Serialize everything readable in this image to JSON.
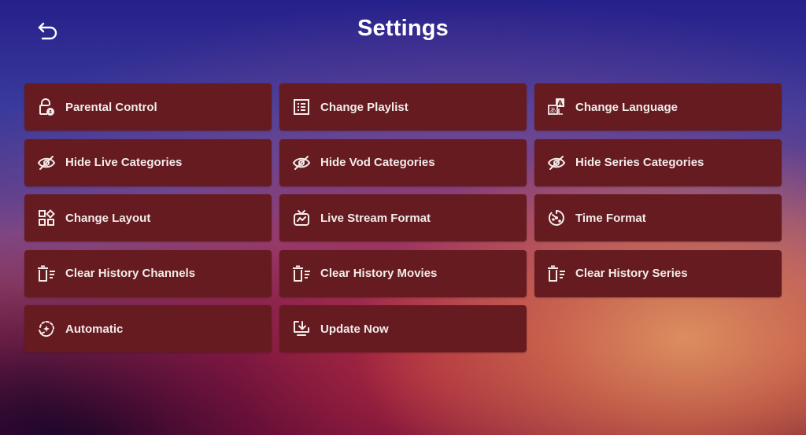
{
  "header": {
    "title": "Settings",
    "back_icon": "back-arrow-icon"
  },
  "settings": [
    {
      "label": "Parental Control",
      "icon": "lock-person-icon"
    },
    {
      "label": "Change Playlist",
      "icon": "list-icon"
    },
    {
      "label": "Change Language",
      "icon": "translate-icon"
    },
    {
      "label": "Hide Live Categories",
      "icon": "eye-off-icon"
    },
    {
      "label": "Hide Vod Categories",
      "icon": "eye-off-icon"
    },
    {
      "label": "Hide Series Categories",
      "icon": "eye-off-icon"
    },
    {
      "label": "Change Layout",
      "icon": "layout-grid-icon"
    },
    {
      "label": "Live Stream Format",
      "icon": "tv-icon"
    },
    {
      "label": "Time Format",
      "icon": "timer-icon"
    },
    {
      "label": "Clear History Channels",
      "icon": "delete-list-icon"
    },
    {
      "label": "Clear History Movies",
      "icon": "delete-list-icon"
    },
    {
      "label": "Clear History Series",
      "icon": "delete-list-icon"
    },
    {
      "label": "Automatic",
      "icon": "auto-refresh-icon"
    },
    {
      "label": "Update Now",
      "icon": "download-screen-icon"
    }
  ],
  "colors": {
    "card": "#651b20",
    "text": "#f3ecea"
  }
}
